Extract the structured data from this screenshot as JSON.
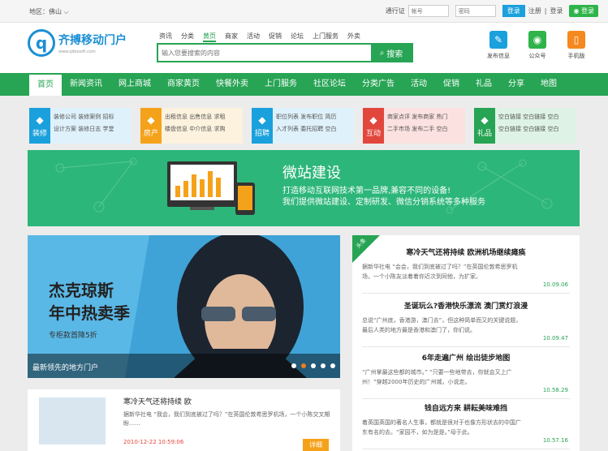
{
  "topbar": {
    "region": "地区：佛山 ⌵",
    "passport": "通行证",
    "user_placeholder": "帐号",
    "pw_placeholder": "密码",
    "login": "登录",
    "register": "注册",
    "logout": "登录",
    "wx_login": "登录"
  },
  "logo": {
    "name": "齐搏移动门户",
    "sub": "www.qibosoft.com"
  },
  "search": {
    "tabs": [
      "资讯",
      "分类",
      "黄页",
      "商家",
      "活动",
      "促销",
      "论坛",
      "上门服务",
      "外卖"
    ],
    "active": 2,
    "placeholder": "输入您要搜索的内容",
    "button": "搜索"
  },
  "quick": [
    {
      "label": "发布信息",
      "color": "#1aa0dc",
      "icon": "✎"
    },
    {
      "label": "公众号",
      "color": "#2eb44a",
      "icon": "◉"
    },
    {
      "label": "手机版",
      "color": "#f5891f",
      "icon": "▯"
    }
  ],
  "nav": [
    "首页",
    "新闻资讯",
    "网上商城",
    "商家黄页",
    "快餐外卖",
    "上门服务",
    "社区论坛",
    "分类广告",
    "活动",
    "促销",
    "礼品",
    "分享",
    "地图"
  ],
  "cats": [
    {
      "label": "装修",
      "color": "#1aa0dc",
      "bg": "#dff1fb",
      "links": [
        "装修公司 装修案例 招标",
        "设计方案 装修日志 学堂"
      ]
    },
    {
      "label": "房产",
      "color": "#f5a21b",
      "bg": "#fdf2de",
      "links": [
        "出租信息 出售信息 求租",
        "楼盘信息 中介信息 求购"
      ]
    },
    {
      "label": "招聘",
      "color": "#1aa0dc",
      "bg": "#dff1fb",
      "links": [
        "职位列表 发布职位 简历",
        "入才列表 委托招聘 空白"
      ]
    },
    {
      "label": "互动",
      "color": "#e2473d",
      "bg": "#fbe1df",
      "links": [
        "商家点评 发布商家 热门",
        "二手市场 发布二手 空白"
      ]
    },
    {
      "label": "礼品",
      "color": "#27a454",
      "bg": "#def3e5",
      "links": [
        "空白链接 空白链接 空白",
        "空白链接 空白链接 空白"
      ]
    }
  ],
  "banner": {
    "title": "微站建设",
    "line1": "打造移动互联网技术第一品牌,兼容不同的设备!",
    "line2": "我们提供微站建设、定制研发、微信分销系统等多种服务"
  },
  "promo": {
    "line1": "杰克琼斯",
    "line2": "年中热卖季",
    "line3": "专柜款首降5折",
    "caption": "最新领先的地方门户"
  },
  "article": {
    "title": "寒冷天气还将持续 欧",
    "desc": "据新华社电 “我会，我们到底被过了吗？”在英国伦敦希思罗机场，一个小陈交叉期盼……",
    "date": "2010-12-22 10:59:06",
    "more": "详细"
  },
  "news": {
    "ribbon": "头条",
    "items": [
      {
        "title": "寒冷天气还将持续 欧洲机场继续瘫痪",
        "desc": "据新华社电 “会会，我们到底被过了吗？”在英国伦敦希思罗机场，一个小陈友淡着着你近次到同他，为扩家。",
        "date": "10.09.06"
      },
      {
        "title": "圣诞玩么?香港快乐漂流 澳门赏灯浪漫",
        "desc": "总说“广州底，香港游，澳门去”，但这种简单而又的关键说题，最后人类的地方最是香港和澳门了，你们说。",
        "date": "10.09.47"
      },
      {
        "title": "6年走遍广州 绘出徒步地图",
        "desc": "“广州掌最这些都的城市。” “只要一些地带去，你就会又上广州！”穿越2000年历史的广州城，小说走。",
        "date": "10.58.29"
      },
      {
        "title": "钱自远方来 耕耘美味难挡",
        "desc": "着英国英国的著名人生事，都就是很对于也像方形状去的中国广东有名的去。“家园不，如为是是。”母于此。",
        "date": "10.57.16"
      }
    ]
  }
}
